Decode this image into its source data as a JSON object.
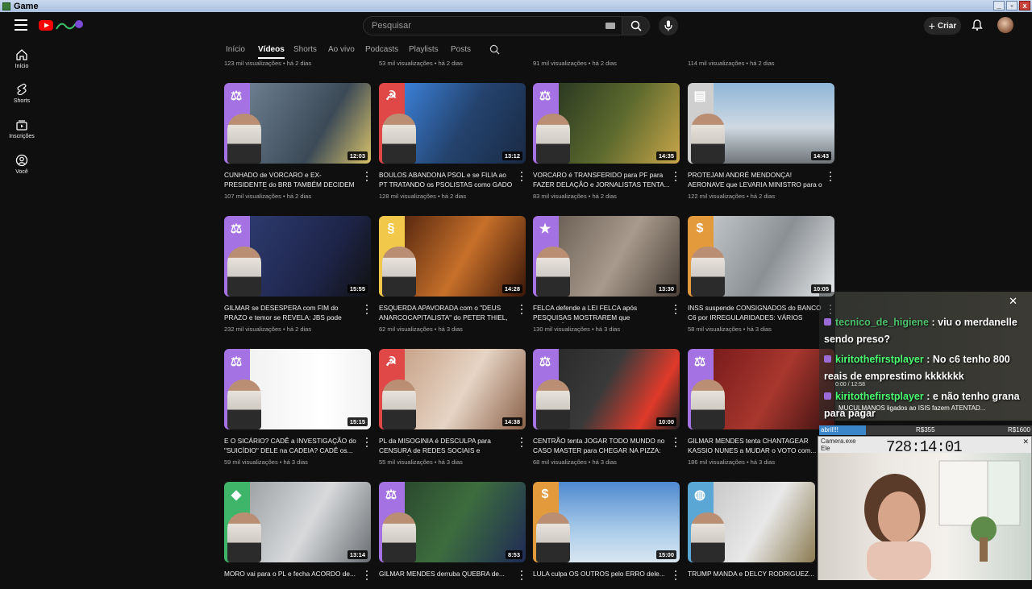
{
  "window": {
    "title": "Game"
  },
  "masthead": {
    "search_placeholder": "Pesquisar",
    "create_label": "Criar"
  },
  "sidebar": {
    "items": [
      {
        "label": "Início",
        "icon": "home-icon"
      },
      {
        "label": "Shorts",
        "icon": "shorts-icon"
      },
      {
        "label": "Inscrições",
        "icon": "subscriptions-icon"
      },
      {
        "label": "Você",
        "icon": "you-icon"
      }
    ]
  },
  "tabs": [
    "Início",
    "Vídeos",
    "Shorts",
    "Ao vivo",
    "Podcasts",
    "Playlists",
    "Posts"
  ],
  "tabs_active": "Vídeos",
  "top_row_meta": [
    "123 mil visualizações • há 2 dias",
    "53 mil visualizações • há 2 dias",
    "91 mil visualizações • há 2 dias",
    "114 mil visualizações • há 2 dias"
  ],
  "videos": [
    {
      "title": "CUNHADO de VORCARO e EX-PRESIDENTE do BRB TAMBÉM DECIDEM fazer DELAÇÃ...",
      "meta": "107 mil visualizações • há 2 dias",
      "duration": "12:03",
      "badge_color": "#a572e3",
      "badge_icon": "⚖",
      "scene": "linear-gradient(120deg,#6b7d8f,#3c4a57 60%,#d8c26a)"
    },
    {
      "title": "BOULOS ABANDONA PSOL e se FILIA ao PT TRATANDO os PSOLISTAS como GADO e...",
      "meta": "128 mil visualizações • há 2 dias",
      "duration": "13:12",
      "badge_color": "#e04848",
      "badge_icon": "☭",
      "scene": "linear-gradient(120deg,#3b7fd6,#24436e 50%,#1a2a44)"
    },
    {
      "title": "VORCARO é TRANSFERIDO para PF para FAZER DELAÇÃO e JORNALISTAS TENTA...",
      "meta": "83 mil visualizações • há 2 dias",
      "duration": "14:35",
      "badge_color": "#a572e3",
      "badge_icon": "⚖",
      "scene": "linear-gradient(120deg,#2b3a22,#5d6a2e 50%,#c9a64a)"
    },
    {
      "title": "PROTEJAM ANDRÉ MENDONÇA! AERONAVE que LEVARIA MINISTRO para o RIO sofre...",
      "meta": "122 mil visualizações • há 2 dias",
      "duration": "14:43",
      "badge_color": "#cfcfcf",
      "badge_icon": "▤",
      "scene": "linear-gradient(180deg,#8fb6d8,#cfd9e2 55%,#6f7478)"
    },
    {
      "title": "GILMAR se DESESPERA com FIM do PRAZO e temor se REVELA: JBS pode ESTAR...",
      "meta": "232 mil visualizações • há 2 dias",
      "duration": "15:55",
      "badge_color": "#a572e3",
      "badge_icon": "⚖",
      "scene": "linear-gradient(120deg,#2d3a6e,#1e254a 60%,#111)"
    },
    {
      "title": "ESQUERDA APAVORADA com o \"DEUS ANARCOCAPITALISTA\" do PETER THIEL, ma...",
      "meta": "62 mil visualizações • há 3 dias",
      "duration": "14:28",
      "badge_color": "#f2c84b",
      "badge_icon": "§",
      "scene": "linear-gradient(120deg,#5a2a10,#c7702a 50%,#3a1608)"
    },
    {
      "title": "FELCA defende a LEI FELCA após PESQUISAS MOSTRAREM que RECEPÇÃO...",
      "meta": "130 mil visualizações • há 3 dias",
      "duration": "13:30",
      "badge_color": "#a572e3",
      "badge_icon": "★",
      "scene": "linear-gradient(120deg,#6e6258,#a89a8c 50%,#4a4038)"
    },
    {
      "title": "INSS suspende CONSIGNADOS do BANCO C6 por IRREGULARIDADES: VÁRIOS OUTR...",
      "meta": "58 mil visualizações • há 3 dias",
      "duration": "10:05",
      "badge_color": "#e39a3c",
      "badge_icon": "$",
      "scene": "linear-gradient(120deg,#bfc3c6,#8b9094 50%,#e6e8ea)"
    },
    {
      "title": "E O SICÁRIO? CADÊ a INVESTIGAÇÃO do \"SUICÍDIO\" DELE na CADEIA? CADÊ os...",
      "meta": "59 mil visualizações • há 3 dias",
      "duration": "15:15",
      "badge_color": "#a572e3",
      "badge_icon": "⚖",
      "scene": "linear-gradient(90deg,#f2f2f2,#ffffff 60%,#f2f2f2)"
    },
    {
      "title": "PL da MISOGINIA é DESCULPA para CENSURA de REDES SOCIAIS e PROIBIÇÃO...",
      "meta": "55 mil visualizações • há 3 dias",
      "duration": "14:38",
      "badge_color": "#e04848",
      "badge_icon": "☭",
      "scene": "linear-gradient(120deg,#c8a48a,#e6d4c4 50%,#8a6048)"
    },
    {
      "title": "CENTRÃO tenta JOGAR TODO MUNDO no CASO MASTER para CHEGAR NA PIZZA: P...",
      "meta": "68 mil visualizações • há 3 dias",
      "duration": "10:00",
      "badge_color": "#a572e3",
      "badge_icon": "⚖",
      "scene": "linear-gradient(120deg,#2b2b2b,#3a3a3a 40%,#e03a2a 75%,#222)"
    },
    {
      "title": "GILMAR MENDES tenta CHANTAGEAR KASSIO NUNES a MUDAR o VOTO com...",
      "meta": "186 mil visualizações • há 3 dias",
      "duration": "",
      "badge_color": "#a572e3",
      "badge_icon": "⚖",
      "scene": "linear-gradient(120deg,#7a1c1c,#a8372e 50%,#3a1010)"
    },
    {
      "title": "MORO vai para o PL e fecha ACORDO de...",
      "meta": "",
      "duration": "13:14",
      "badge_color": "#3fb56a",
      "badge_icon": "◆",
      "scene": "linear-gradient(120deg,#9fa3a6,#d7d9db 50%,#6a6e72)"
    },
    {
      "title": "GILMAR MENDES derruba QUEBRA de...",
      "meta": "",
      "duration": "8:53",
      "badge_color": "#a572e3",
      "badge_icon": "⚖",
      "scene": "linear-gradient(120deg,#2b4a2e,#3d6d3e 45%,#1f2a55)"
    },
    {
      "title": "LULA culpa OS OUTROS pelo ERRO dele...",
      "meta": "",
      "duration": "15:00",
      "badge_color": "#e39a3c",
      "badge_icon": "$",
      "scene": "linear-gradient(180deg,#4e89cf,#a9cbe9 60%,#d9e6f1)"
    },
    {
      "title": "TRUMP MANDA e DELCY RODRIGUEZ...",
      "meta": "",
      "duration": "",
      "badge_color": "#5aa7d6",
      "badge_icon": "◍",
      "scene": "linear-gradient(120deg,#c9c9c9,#e8e8e8 50%,#8a7a50)"
    }
  ],
  "chat": {
    "messages": [
      {
        "user": "tecnico_de_higiene",
        "text": " : viu o merdanelle sendo preso?"
      },
      {
        "user": "kiritothefirstplayer",
        "text": " : No c6 tenho 800 reais de emprestimo kkkkkkk"
      },
      {
        "user": "kiritothefirstplayer",
        "text": " : e não tenho grana para pagar"
      }
    ],
    "ticker": "MUCULMANOS ligados ao ISIS fazem ATENTAD...",
    "time": "0:00 / 12:58",
    "close": "✕"
  },
  "goal_bar": {
    "label": "abril!!!",
    "mid": "R$355",
    "right": "R$1600",
    "fill": 0.22
  },
  "camera": {
    "title": "Camera.exe",
    "file": "Ele",
    "timer": "728:14:01"
  },
  "colors": {
    "accent": "#ff0000",
    "chat_user": "#4cff72",
    "bg": "#0f0f0f"
  }
}
